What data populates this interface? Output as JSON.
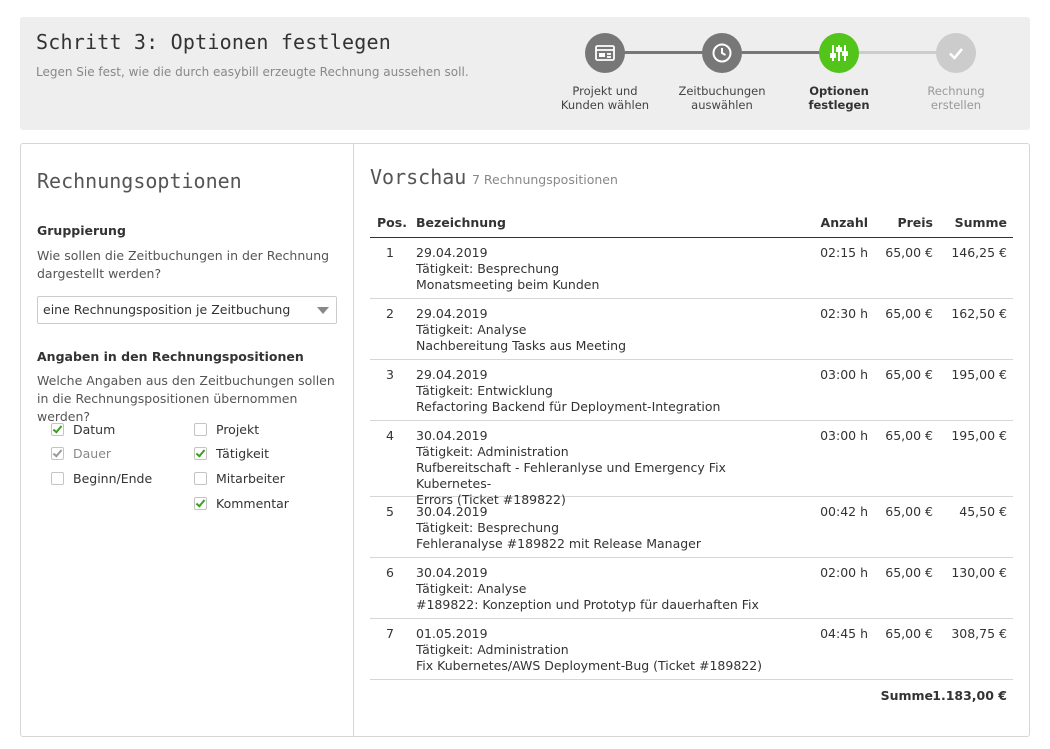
{
  "header": {
    "title": "Schritt 3: Optionen festlegen",
    "subtitle": "Legen Sie fest, wie die durch easybill erzeugte Rechnung aussehen soll."
  },
  "wizard": {
    "steps": [
      {
        "label_line1": "Projekt und",
        "label_line2": "Kunden wählen",
        "icon": "card-icon",
        "state": "done"
      },
      {
        "label_line1": "Zeitbuchungen",
        "label_line2": "auswählen",
        "icon": "clock-icon",
        "state": "done"
      },
      {
        "label_line1": "Optionen",
        "label_line2": "festlegen",
        "icon": "sliders-icon",
        "state": "active"
      },
      {
        "label_line1": "Rechnung",
        "label_line2": "erstellen",
        "icon": "check-icon",
        "state": "todo"
      }
    ],
    "colors": {
      "done": "#777777",
      "active": "#52c41a",
      "todo": "#cccccc"
    }
  },
  "options": {
    "title": "Rechnungsoptionen",
    "grouping": {
      "heading": "Gruppierung",
      "question": "Wie sollen die Zeitbuchungen in der Rechnung dargestellt werden?",
      "selected": "eine Rechnungsposition je Zeitbuchung"
    },
    "fields": {
      "heading": "Angaben in den Rechnungspositionen",
      "question": "Welche Angaben aus den Zeitbuchungen sollen in die Rechnungspositionen übernommen werden?",
      "checkboxes": [
        {
          "label": "Datum",
          "checked": true,
          "disabled": false
        },
        {
          "label": "Dauer",
          "checked": true,
          "disabled": true
        },
        {
          "label": "Beginn/Ende",
          "checked": false,
          "disabled": false
        },
        {
          "label": "Projekt",
          "checked": false,
          "disabled": false
        },
        {
          "label": "Tätigkeit",
          "checked": true,
          "disabled": false
        },
        {
          "label": "Mitarbeiter",
          "checked": false,
          "disabled": false
        },
        {
          "label": "Kommentar",
          "checked": true,
          "disabled": false
        }
      ]
    }
  },
  "preview": {
    "title": "Vorschau",
    "count": "7 Rechnungspositionen",
    "columns": {
      "pos": "Pos.",
      "desc": "Bezeichnung",
      "qty": "Anzahl",
      "price": "Preis",
      "sum": "Summe"
    },
    "rows": [
      {
        "pos": "1",
        "lines": [
          "29.04.2019",
          "Tätigkeit: Besprechung",
          "Monatsmeeting beim Kunden"
        ],
        "qty": "02:15 h",
        "price": "65,00 €",
        "sum": "146,25 €"
      },
      {
        "pos": "2",
        "lines": [
          "29.04.2019",
          "Tätigkeit: Analyse",
          "Nachbereitung Tasks aus Meeting"
        ],
        "qty": "02:30 h",
        "price": "65,00 €",
        "sum": "162,50 €"
      },
      {
        "pos": "3",
        "lines": [
          "29.04.2019",
          "Tätigkeit: Entwicklung",
          "Refactoring Backend für Deployment-Integration"
        ],
        "qty": "03:00 h",
        "price": "65,00 €",
        "sum": "195,00 €"
      },
      {
        "pos": "4",
        "lines": [
          "30.04.2019",
          "Tätigkeit: Administration",
          "Rufbereitschaft - Fehleranlyse und Emergency Fix Kubernetes-",
          "Errors (Ticket #189822)"
        ],
        "qty": "03:00 h",
        "price": "65,00 €",
        "sum": "195,00 €"
      },
      {
        "pos": "5",
        "lines": [
          "30.04.2019",
          "Tätigkeit: Besprechung",
          "Fehleranalyse #189822 mit Release Manager"
        ],
        "qty": "00:42 h",
        "price": "65,00 €",
        "sum": "45,50 €"
      },
      {
        "pos": "6",
        "lines": [
          "30.04.2019",
          "Tätigkeit: Analyse",
          "#189822: Konzeption und Prototyp für dauerhaften Fix"
        ],
        "qty": "02:00 h",
        "price": "65,00 €",
        "sum": "130,00 €"
      },
      {
        "pos": "7",
        "lines": [
          "01.05.2019",
          "Tätigkeit: Administration",
          "Fix Kubernetes/AWS Deployment-Bug (Ticket #189822)"
        ],
        "qty": "04:45 h",
        "price": "65,00 €",
        "sum": "308,75 €"
      }
    ],
    "total_label": "Summe",
    "total_value": "1.183,00 €"
  }
}
